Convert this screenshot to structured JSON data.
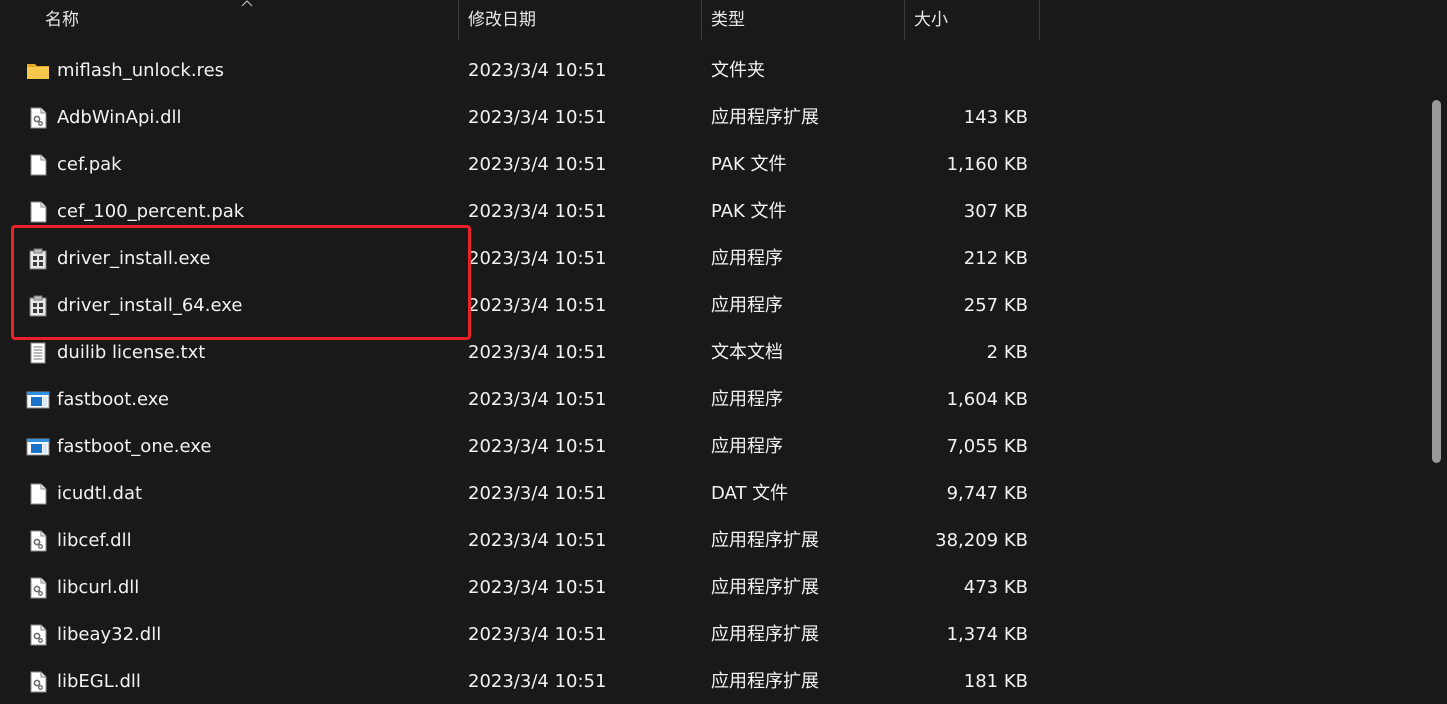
{
  "columns": {
    "name": "名称",
    "date": "修改日期",
    "type": "类型",
    "size": "大小"
  },
  "files": [
    {
      "name": "miflash_unlock.res",
      "date": "2023/3/4 10:51",
      "type": "文件夹",
      "size": "",
      "icon": "folder-icon"
    },
    {
      "name": "AdbWinApi.dll",
      "date": "2023/3/4 10:51",
      "type": "应用程序扩展",
      "size": "143 KB",
      "icon": "dll-file-icon"
    },
    {
      "name": "cef.pak",
      "date": "2023/3/4 10:51",
      "type": "PAK 文件",
      "size": "1,160 KB",
      "icon": "blank-file-icon"
    },
    {
      "name": "cef_100_percent.pak",
      "date": "2023/3/4 10:51",
      "type": "PAK 文件",
      "size": "307 KB",
      "icon": "blank-file-icon"
    },
    {
      "name": "driver_install.exe",
      "date": "2023/3/4 10:51",
      "type": "应用程序",
      "size": "212 KB",
      "icon": "installer-icon"
    },
    {
      "name": "driver_install_64.exe",
      "date": "2023/3/4 10:51",
      "type": "应用程序",
      "size": "257 KB",
      "icon": "installer-icon"
    },
    {
      "name": "duilib license.txt",
      "date": "2023/3/4 10:51",
      "type": "文本文档",
      "size": "2 KB",
      "icon": "text-file-icon"
    },
    {
      "name": "fastboot.exe",
      "date": "2023/3/4 10:51",
      "type": "应用程序",
      "size": "1,604 KB",
      "icon": "application-icon"
    },
    {
      "name": "fastboot_one.exe",
      "date": "2023/3/4 10:51",
      "type": "应用程序",
      "size": "7,055 KB",
      "icon": "application-icon"
    },
    {
      "name": "icudtl.dat",
      "date": "2023/3/4 10:51",
      "type": "DAT 文件",
      "size": "9,747 KB",
      "icon": "blank-file-icon"
    },
    {
      "name": "libcef.dll",
      "date": "2023/3/4 10:51",
      "type": "应用程序扩展",
      "size": "38,209 KB",
      "icon": "dll-file-icon"
    },
    {
      "name": "libcurl.dll",
      "date": "2023/3/4 10:51",
      "type": "应用程序扩展",
      "size": "473 KB",
      "icon": "dll-file-icon"
    },
    {
      "name": "libeay32.dll",
      "date": "2023/3/4 10:51",
      "type": "应用程序扩展",
      "size": "1,374 KB",
      "icon": "dll-file-icon"
    },
    {
      "name": "libEGL.dll",
      "date": "2023/3/4 10:51",
      "type": "应用程序扩展",
      "size": "181 KB",
      "icon": "dll-file-icon"
    }
  ],
  "colors": {
    "background": "#191919",
    "highlight_border": "#e8212b",
    "folder": "#f3c24a",
    "text": "#f2f2f2"
  }
}
